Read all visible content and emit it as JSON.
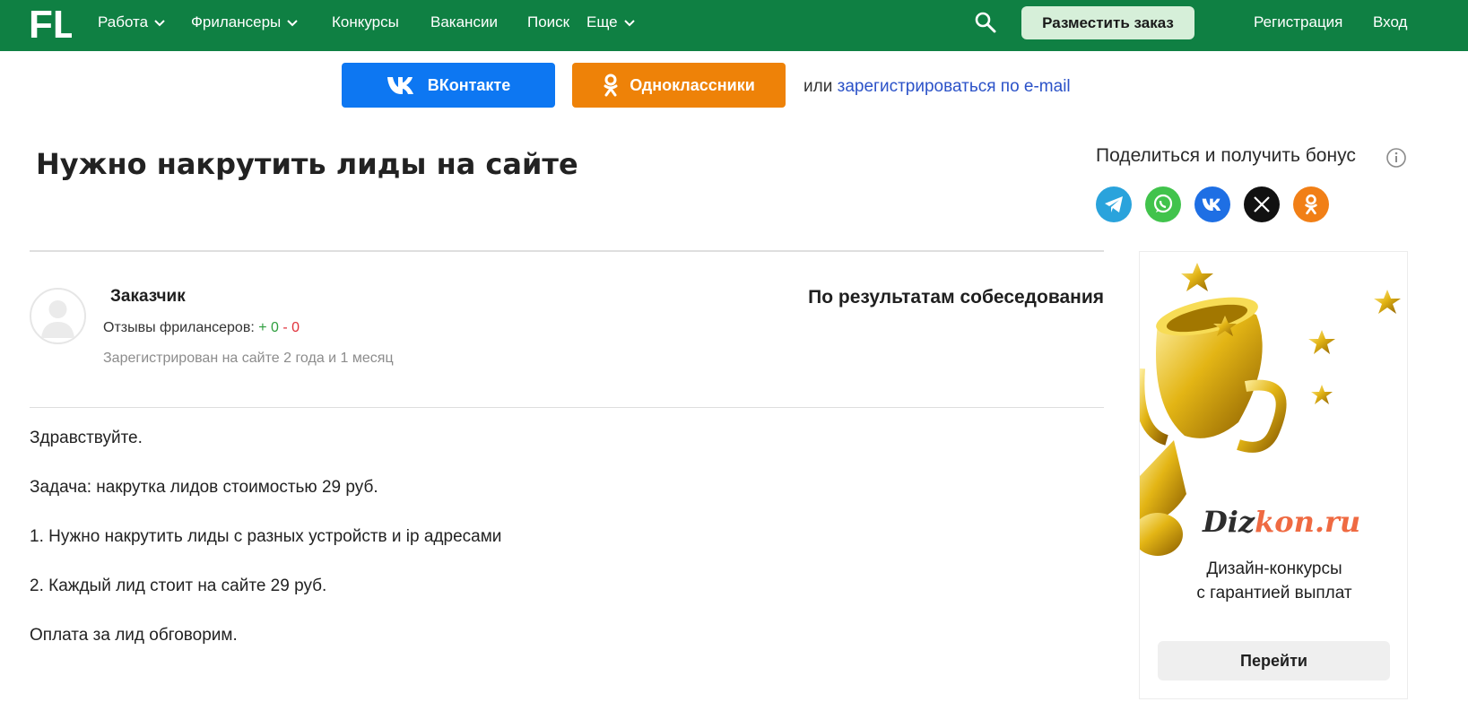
{
  "header": {
    "logo_text": "FL",
    "nav": [
      {
        "label": "Работа",
        "has_dropdown": true
      },
      {
        "label": "Фрилансеры",
        "has_dropdown": true
      },
      {
        "label": "Конкурсы",
        "has_dropdown": false
      },
      {
        "label": "Вакансии",
        "has_dropdown": false
      },
      {
        "label": "Поиск",
        "has_dropdown": false
      },
      {
        "label": "Еще",
        "has_dropdown": true
      }
    ],
    "post_order_label": "Разместить заказ",
    "register_label": "Регистрация",
    "login_label": "Вход",
    "brand_color": "#0f8043"
  },
  "auth": {
    "vk_label": "ВКонтакте",
    "ok_label": "Одноклассники",
    "or_text": "или",
    "email_link": "зарегистрироваться по e-mail"
  },
  "project": {
    "title": "Нужно накрутить лиды на сайте",
    "budget": "По результатам собеседования",
    "customer": {
      "name": "Заказчик",
      "reviews_label": "Отзывы фрилансеров:",
      "reviews_positive": "+ 0",
      "reviews_negative": "- 0",
      "registered": "Зарегистрирован на сайте 2 года и 1 месяц"
    },
    "description": [
      "Здравствуйте.",
      "Задача: накрутка лидов стоимостью 29 руб.",
      "1. Нужно накрутить лиды с разных устройств и ip адресами",
      "2. Каждый лид стоит на сайте 29 руб.",
      "Оплата за лид обговорим."
    ]
  },
  "share": {
    "title": "Поделиться и получить бонус",
    "icons": [
      "telegram-icon",
      "whatsapp-icon",
      "vk-icon",
      "x-icon",
      "odnoklassniki-icon"
    ]
  },
  "ad": {
    "brand_part1": "Diz",
    "brand_part2": "kon.ru",
    "caption_line1": "Дизайн-конкурсы",
    "caption_line2": "с гарантией выплат",
    "button_label": "Перейти"
  }
}
